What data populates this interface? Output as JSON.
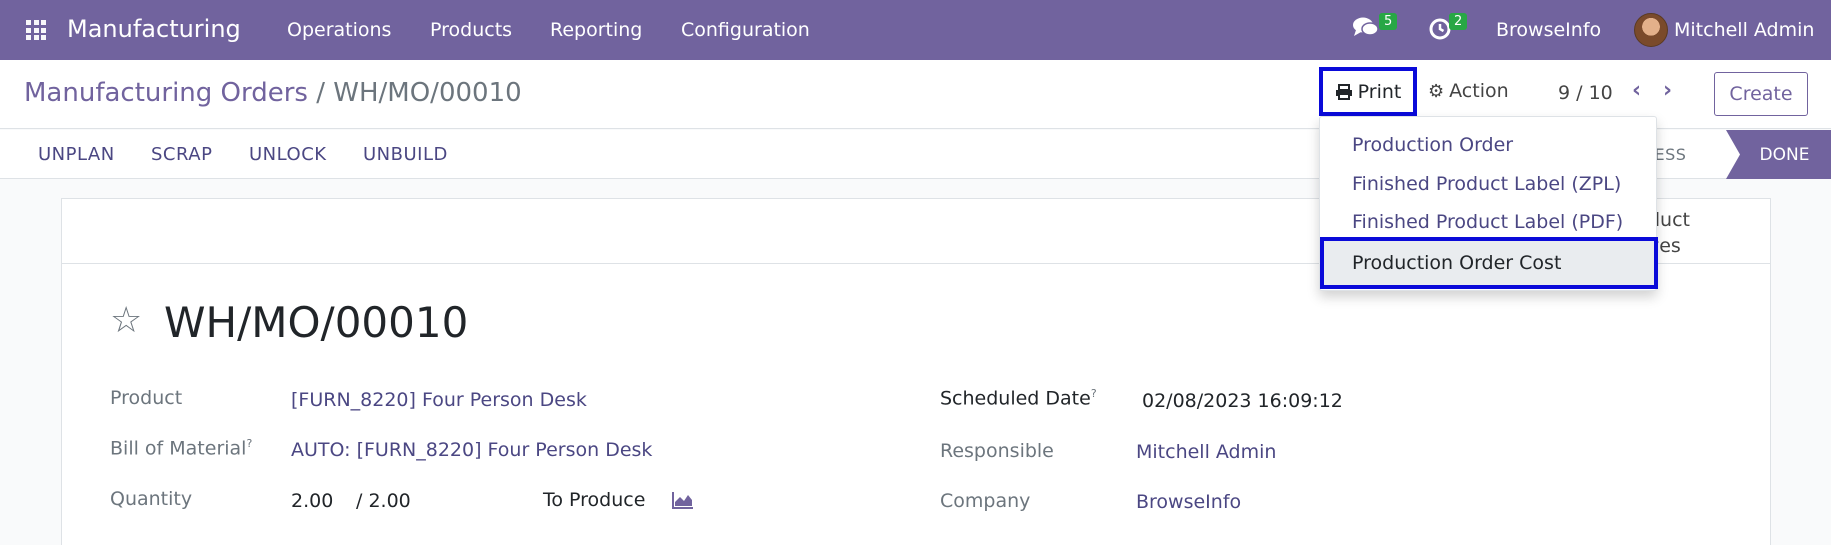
{
  "navbar": {
    "app_name": "Manufacturing",
    "menus": [
      "Operations",
      "Products",
      "Reporting",
      "Configuration"
    ],
    "messages_count": "5",
    "activities_count": "2",
    "company": "BrowseInfo",
    "user": "Mitchell Admin"
  },
  "control": {
    "breadcrumb_parent": "Manufacturing Orders",
    "breadcrumb_sep": "/",
    "breadcrumb_current": "WH/MO/00010",
    "print_label": "Print",
    "action_label": "Action",
    "pager": "9 / 10",
    "create_label": "Create"
  },
  "statusbar": {
    "buttons": [
      "UNPLAN",
      "SCRAP",
      "UNLOCK",
      "UNBUILD"
    ],
    "stage_partial": "GRESS",
    "stage_done": "DONE"
  },
  "print_menu": {
    "items": [
      "Production Order",
      "Finished Product Label (ZPL)",
      "Finished Product Label (PDF)",
      "Production Order Cost"
    ]
  },
  "form": {
    "smart_button_partial_1": "duct",
    "smart_button_partial_2": "ves",
    "title": "WH/MO/00010",
    "product_label": "Product",
    "product_value": "[FURN_8220] Four Person Desk",
    "bom_label": "Bill of Material",
    "bom_value": "AUTO: [FURN_8220] Four Person Desk",
    "quantity_label": "Quantity",
    "quantity_value": "2.00",
    "quantity_total": "/ 2.00",
    "to_produce_label": "To Produce",
    "scheduled_label": "Scheduled Date",
    "scheduled_value": "02/08/2023 16:09:12",
    "responsible_label": "Responsible",
    "responsible_value": "Mitchell Admin",
    "company_label": "Company",
    "company_value": "BrowseInfo",
    "help_mark": "?"
  },
  "colors": {
    "brand": "#71639e",
    "link": "#4b4783",
    "highlight": "#0a0ad9",
    "badge": "#28a745"
  }
}
